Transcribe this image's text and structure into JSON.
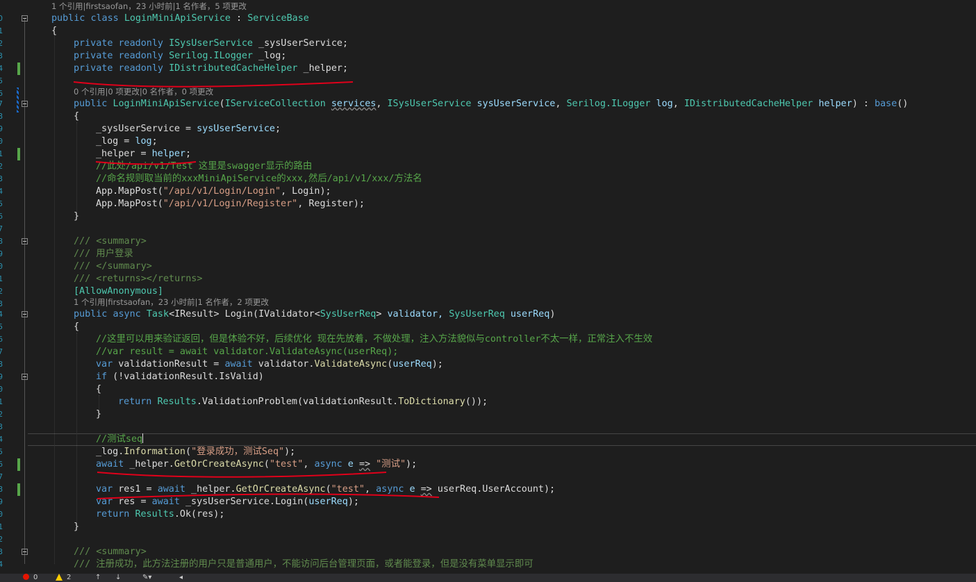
{
  "editor": {
    "line_number_digits": [
      "0",
      "1",
      "2",
      "3",
      "4",
      "5",
      "6",
      "7",
      "8",
      "9",
      "0",
      "1",
      "2",
      "3",
      "4",
      "5",
      "6",
      "7",
      "8",
      "9",
      "0",
      "1",
      "2",
      "3",
      "4",
      "5",
      "6",
      "7",
      "8",
      "9",
      "0",
      "1",
      "2",
      "3",
      "4",
      "5",
      "6",
      "7",
      "8",
      "9",
      "0",
      "1",
      "2",
      "3",
      "4",
      "5"
    ],
    "codelens": {
      "class": "1 个引用|firstsaofan，23 小时前|1 名作者，5 项更改",
      "ctor": "0 个引用|0 项更改|0 名作者，0 项更改",
      "login": "1 个引用|firstsaofan，23 小时前|1 名作者，2 项更改"
    },
    "code": {
      "kw_public": "public",
      "kw_class": "class",
      "class_name": "LoginMiniApiService",
      "colon": " : ",
      "base_type": "ServiceBase",
      "brace_open": "{",
      "brace_close": "}",
      "kw_private": "private",
      "kw_readonly": "readonly",
      "f1_type": "ISysUserService",
      "f1_name": " _sysUserService;",
      "f2_type": "Serilog.ILogger",
      "f2_name": " _log;",
      "f3_type": "IDistributedCacheHelper",
      "f3_name": " _helper;",
      "ctor_name": "LoginMiniApiService",
      "ctor_p1_type": "IServiceCollection",
      "ctor_p1_name": "services",
      "comma": ", ",
      "ctor_p2_type": "ISysUserService",
      "ctor_p2_name": "sysUserService",
      "ctor_p3_type": "Serilog.ILogger",
      "ctor_p3_name": "log",
      "ctor_p4_type": "IDistributedCacheHelper",
      "ctor_p4_name": "helper",
      "ctor_tail": ") : ",
      "kw_base": "base",
      "parens": "()",
      "assign1_l": "_sysUserService = ",
      "assign1_r": "sysUserService",
      "assign2_l": "_log = ",
      "assign2_r": "log",
      "assign3_l": "_helper = ",
      "assign3_r": "helper",
      "semi": ";",
      "cm_route1": "//此处/api/v1/Test 这里是swagger显示的路由",
      "cm_route2": "//命名规则取当前的xxxMiniApiService的xxx,然后/api/v1/xxx/方法名",
      "app_map": "App.MapPost",
      "map1_str": "\"/api/v1/Login/Login\"",
      "map1_arg": ", Login",
      "map2_str": "\"/api/v1/Login/Register\"",
      "map2_arg": ", Register",
      "paren_semi": ");",
      "xd_summary_open": "/// <summary>",
      "xd_login": "/// 用户登录",
      "xd_summary_close": "/// </summary>",
      "xd_returns": "/// <returns></returns>",
      "attr_allow": "[AllowAnonymous]",
      "kw_async": "async",
      "task_type": "Task",
      "iresult": "<IResult>",
      "login_name": " Login(",
      "ivalidator": "IValidator",
      "sysuserreq": "SysUserReq",
      "angle_close": ">",
      "validator_name": " validator, ",
      "userreq_type": "SysUserReq",
      "userreq_name": " userReq",
      "close_paren": ")",
      "cm_validate1": "//这里可以用来验证返回，但是体验不好，后续优化 现在先放着，不做处理，注入方法貌似与controller不太一样，正常注入不生效",
      "cm_validate2": "//var result = await validator.ValidateAsync(userReq);",
      "kw_var": "var",
      "validation_result": " validationResult = ",
      "kw_await": "await",
      "validator_call": " validator.",
      "validate_async": "ValidateAsync",
      "userreq_arg": "userReq",
      "kw_if": "if",
      "not_valid": " (!validationResult.IsValid)",
      "kw_return": "return",
      "results": "Results",
      "validation_problem": ".ValidationProblem(validationResult.",
      "to_dictionary": "ToDictionary",
      "close_all": "());",
      "cm_seq": "//测试seq",
      "log_info": "_log.",
      "information": "Information",
      "info_str": "\"登录成功，测试Seq\"",
      "helper_call": " _helper.",
      "get_or_create": "GetOrCreateAsync",
      "test_str": "\"test\"",
      "lambda_e": " e ",
      "arrow": "=>",
      "test_cn_str": "\"测试\"",
      "res1_decl": " res1 = ",
      "user_account": " userReq.UserAccount",
      "res_decl": " res = ",
      "sys_login": " _sysUserService.Login(",
      "ok_call": ".Ok(res);",
      "xd_register": "/// 注册成功，此方法注册的用户只是普通用户，不能访问后台管理页面，或者能登录，但是没有菜单显示即可"
    }
  },
  "status_bar": {
    "errors": "0",
    "warnings": "2",
    "up_arrow": "↑",
    "down_arrow": "↓",
    "brush": "✎▾",
    "left_arrow": "◂"
  },
  "colors": {
    "background": "#1e1e1e",
    "keyword": "#569cd6",
    "type": "#4ec9b0",
    "string": "#d69d85",
    "comment": "#57a64a",
    "annotation_ink": "#e0001a"
  }
}
